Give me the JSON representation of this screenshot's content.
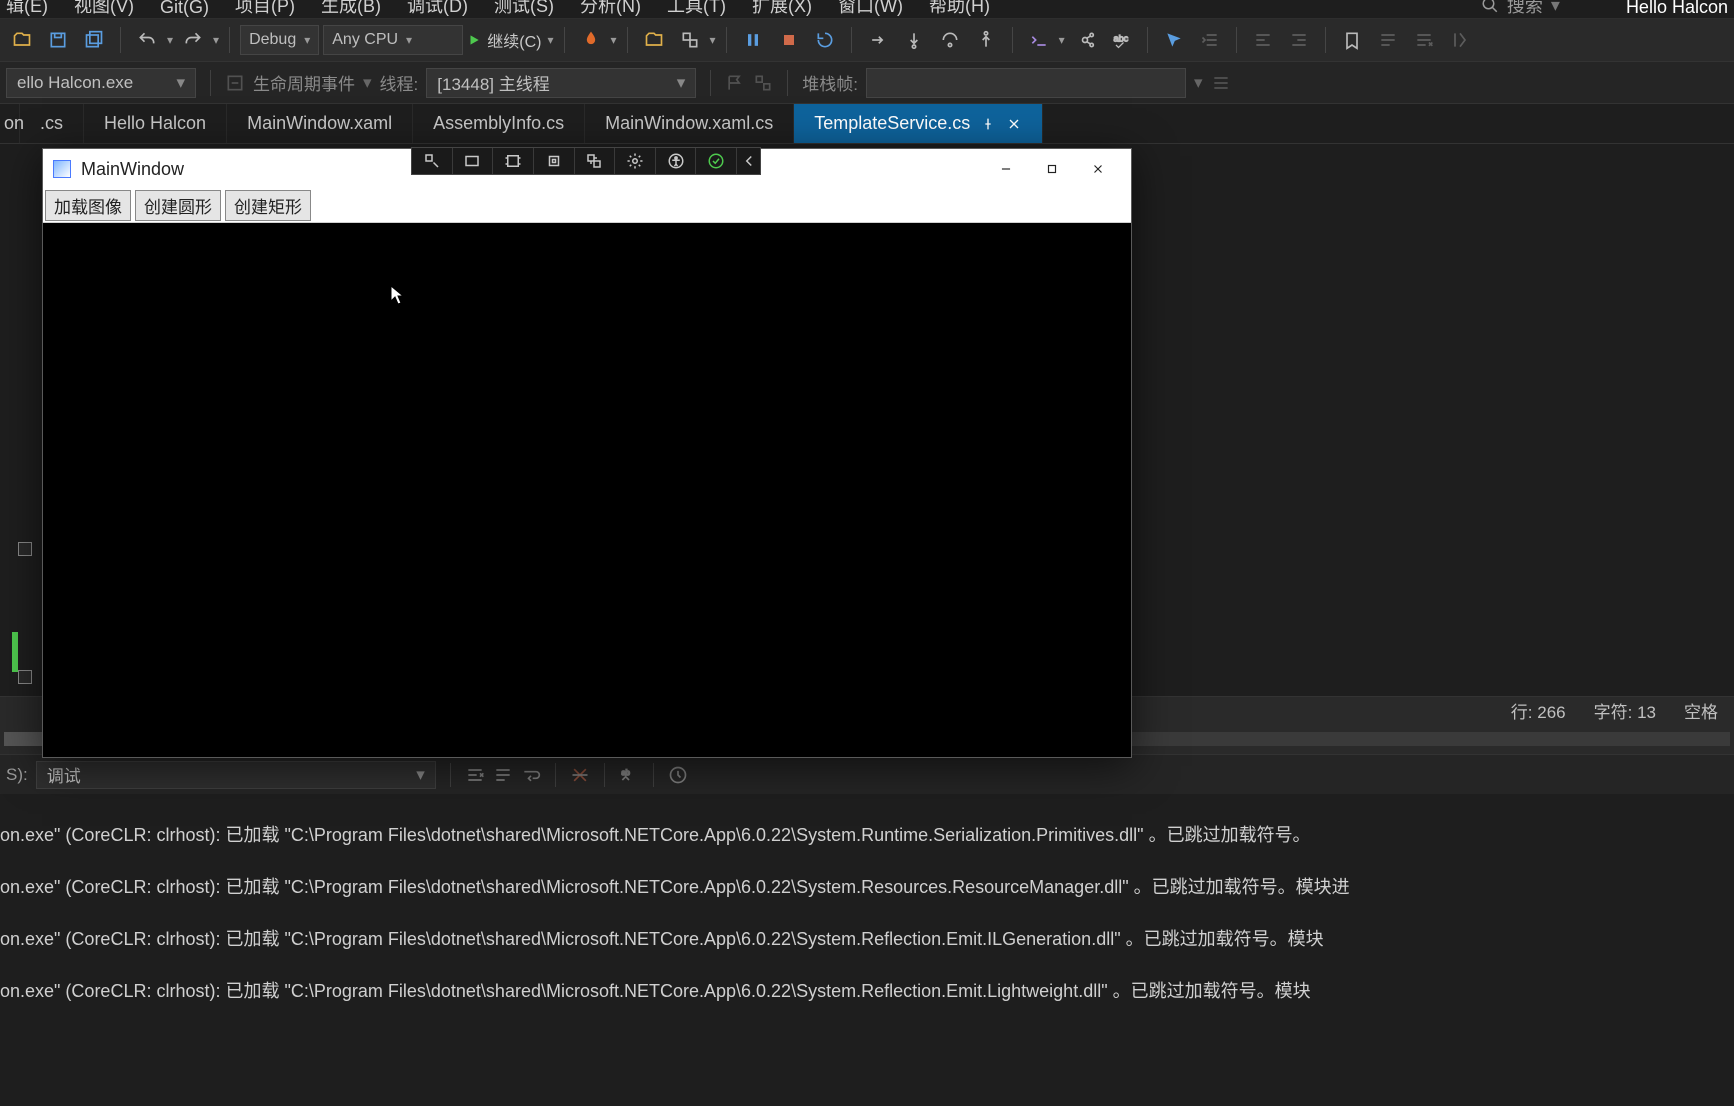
{
  "menu": {
    "items": [
      "辑(E)",
      "视图(V)",
      "Git(G)",
      "项目(P)",
      "生成(B)",
      "调试(D)",
      "测试(S)",
      "分析(N)",
      "工具(T)",
      "扩展(X)",
      "窗口(W)",
      "帮助(H)"
    ],
    "search_placeholder": "搜索",
    "app_name": "Hello Halcon"
  },
  "toolbar": {
    "config": "Debug",
    "platform": "Any CPU",
    "continue_label": "继续(C)"
  },
  "debugbar": {
    "process": "ello Halcon.exe",
    "lifecycle_label": "生命周期事件",
    "thread_prefix": "线程:",
    "thread_value": "[13448] 主线程",
    "stack_label": "堆栈帧:"
  },
  "tabs": [
    {
      "label": ".cs",
      "active": false
    },
    {
      "label": "Hello Halcon",
      "active": false
    },
    {
      "label": "MainWindow.xaml",
      "active": false
    },
    {
      "label": "AssemblyInfo.cs",
      "active": false
    },
    {
      "label": "MainWindow.xaml.cs",
      "active": false
    },
    {
      "label": "TemplateService.cs",
      "active": true
    }
  ],
  "childwin": {
    "title": "MainWindow",
    "buttons": [
      "加载图像",
      "创建圆形",
      "创建矩形"
    ]
  },
  "status": {
    "line_label": "行:",
    "line": "266",
    "char_label": "字符:",
    "char": "13",
    "spaces_label": "空格"
  },
  "outbar": {
    "prefix": "S):",
    "source": "调试"
  },
  "output_lines": [
    "on.exe\" (CoreCLR: clrhost): 已加载 \"C:\\Program Files\\dotnet\\shared\\Microsoft.NETCore.App\\6.0.22\\System.Runtime.Serialization.Primitives.dll\" 。已跳过加载符号。",
    "on.exe\" (CoreCLR: clrhost): 已加载 \"C:\\Program Files\\dotnet\\shared\\Microsoft.NETCore.App\\6.0.22\\System.Resources.ResourceManager.dll\" 。已跳过加载符号。模块进",
    "on.exe\" (CoreCLR: clrhost): 已加载 \"C:\\Program Files\\dotnet\\shared\\Microsoft.NETCore.App\\6.0.22\\System.Reflection.Emit.ILGeneration.dll\" 。已跳过加载符号。模块",
    "on.exe\" (CoreCLR: clrhost): 已加载 \"C:\\Program Files\\dotnet\\shared\\Microsoft.NETCore.App\\6.0.22\\System.Reflection.Emit.Lightweight.dll\" 。已跳过加载符号。模块"
  ],
  "side_tab": "on"
}
